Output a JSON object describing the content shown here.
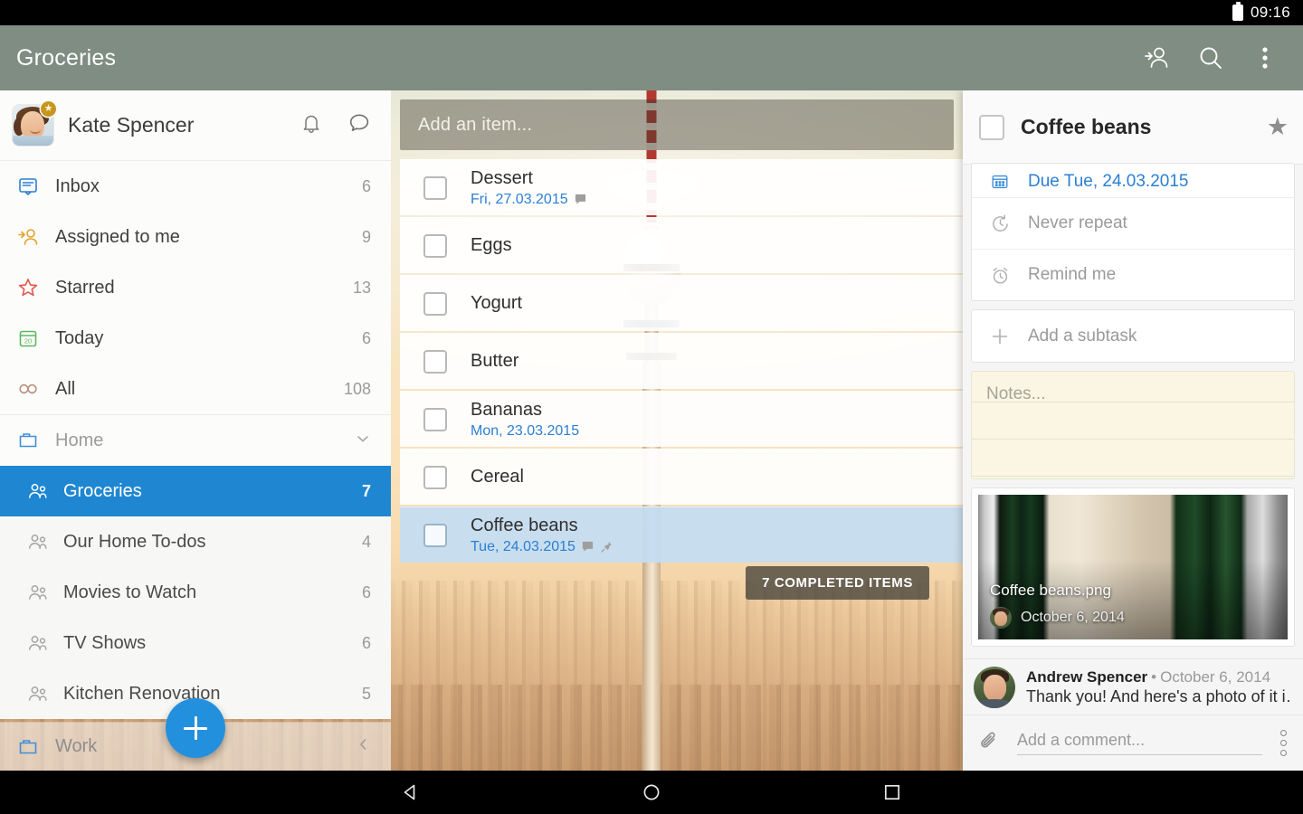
{
  "status_bar": {
    "time": "09:16",
    "battery_icon": "battery-icon"
  },
  "app_bar": {
    "title": "Groceries",
    "actions": [
      {
        "name": "add-person-icon",
        "label": "Add person"
      },
      {
        "name": "search-icon",
        "label": "Search"
      },
      {
        "name": "overflow-menu-icon",
        "label": "More options"
      }
    ]
  },
  "sidebar": {
    "profile": {
      "name": "Kate Spencer",
      "badge_icon": "star-badge",
      "actions": [
        {
          "name": "notifications-bell-icon",
          "label": "Notifications"
        },
        {
          "name": "chat-bubble-icon",
          "label": "Messages"
        }
      ]
    },
    "smart_lists": [
      {
        "label": "Inbox",
        "count": "6",
        "icon": "inbox-icon",
        "color": "#2f7fd1"
      },
      {
        "label": "Assigned to me",
        "count": "9",
        "icon": "assigned-icon",
        "color": "#e0a22a"
      },
      {
        "label": "Starred",
        "count": "13",
        "icon": "star-icon",
        "color": "#e05a4e"
      },
      {
        "label": "Today",
        "count": "6",
        "icon": "calendar-icon",
        "color": "#5cb85c"
      },
      {
        "label": "All",
        "count": "108",
        "icon": "infinity-icon",
        "color": "#b8907a"
      }
    ],
    "groups": [
      {
        "label": "Home",
        "icon": "folder-icon",
        "chevron": "chevron-down-icon",
        "lists": [
          {
            "label": "Groceries",
            "count": "7",
            "icon": "shared-list-icon",
            "selected": true
          },
          {
            "label": "Our Home To-dos",
            "count": "4",
            "icon": "shared-list-icon",
            "selected": false
          },
          {
            "label": "Movies to Watch",
            "count": "6",
            "icon": "shared-list-icon",
            "selected": false
          },
          {
            "label": "TV Shows",
            "count": "6",
            "icon": "shared-list-icon",
            "selected": false
          },
          {
            "label": "Kitchen Renovation",
            "count": "5",
            "icon": "shared-list-icon",
            "selected": false
          }
        ]
      },
      {
        "label": "Work",
        "icon": "folder-icon",
        "chevron": "chevron-left-icon",
        "lists": []
      }
    ],
    "fab": {
      "name": "add-task-fab",
      "icon": "plus-icon",
      "color": "#2390dd"
    }
  },
  "center": {
    "add_item_placeholder": "Add an item...",
    "tasks": [
      {
        "title": "Dessert",
        "due": "Fri, 27.03.2015",
        "has_comment": true,
        "has_pin": false,
        "selected": false,
        "checked": false
      },
      {
        "title": "Eggs",
        "due": "",
        "has_comment": false,
        "has_pin": false,
        "selected": false,
        "checked": false
      },
      {
        "title": "Yogurt",
        "due": "",
        "has_comment": false,
        "has_pin": false,
        "selected": false,
        "checked": false
      },
      {
        "title": "Butter",
        "due": "",
        "has_comment": false,
        "has_pin": false,
        "selected": false,
        "checked": false
      },
      {
        "title": "Bananas",
        "due": "Mon, 23.03.2015",
        "has_comment": false,
        "has_pin": false,
        "selected": false,
        "checked": false
      },
      {
        "title": "Cereal",
        "due": "",
        "has_comment": false,
        "has_pin": false,
        "selected": false,
        "checked": false
      },
      {
        "title": "Coffee beans",
        "due": "Tue, 24.03.2015",
        "has_comment": true,
        "has_pin": true,
        "selected": true,
        "checked": false
      }
    ],
    "completed_button": "7 COMPLETED ITEMS"
  },
  "detail": {
    "title": "Coffee beans",
    "checked": false,
    "star_icon": "star-filled-icon",
    "rows": [
      {
        "label": "Due Tue, 24.03.2015",
        "icon": "calendar-icon",
        "accent": true
      },
      {
        "label": "Never repeat",
        "icon": "repeat-icon",
        "accent": false
      },
      {
        "label": "Remind me",
        "icon": "alarm-icon",
        "accent": false
      }
    ],
    "subtask_label": "Add a subtask",
    "subtask_icon": "plus-icon",
    "notes_placeholder": "Notes...",
    "attachment": {
      "filename": "Coffee beans.png",
      "date": "October 6, 2014"
    },
    "comment": {
      "author": "Andrew Spencer",
      "separator": "•",
      "date": "October 6, 2014",
      "text": "Thank you! And here's a photo of it in ca..."
    },
    "add_comment_placeholder": "Add a comment...",
    "attach_icon": "paperclip-icon",
    "more_icon": "more-vertical-icon"
  },
  "nav_bar": {
    "buttons": [
      {
        "name": "back-button",
        "icon": "triangle-left-icon"
      },
      {
        "name": "home-button",
        "icon": "circle-icon"
      },
      {
        "name": "recents-button",
        "icon": "square-icon"
      }
    ]
  },
  "colors": {
    "appbar": "#808d82",
    "accent_blue": "#1f87d2",
    "fab_blue": "#2390dd",
    "link_blue": "#2b7fd4",
    "notes_yellow": "#faf6e3"
  }
}
